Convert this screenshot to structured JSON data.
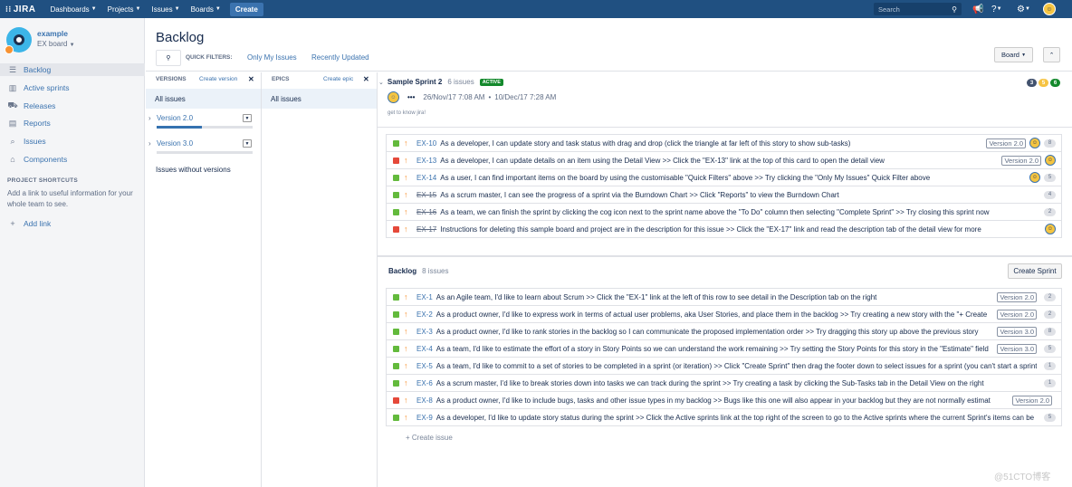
{
  "topnav": {
    "logo": "JIRA",
    "menus": [
      {
        "label": "Dashboards",
        "has_caret": true
      },
      {
        "label": "Projects",
        "has_caret": true
      },
      {
        "label": "Issues",
        "has_caret": true
      },
      {
        "label": "Boards",
        "has_caret": true
      }
    ],
    "create_label": "Create",
    "search_placeholder": "Search",
    "icons": [
      "megaphone-icon",
      "help-icon",
      "gear-icon",
      "user-avatar-icon"
    ]
  },
  "sidebar": {
    "project_name": "example",
    "board_name": "EX board",
    "nav": [
      {
        "label": "Backlog",
        "icon": "backlog-icon",
        "active": true
      },
      {
        "label": "Active sprints",
        "icon": "sprint-board-icon",
        "active": false
      },
      {
        "label": "Releases",
        "icon": "releases-icon",
        "active": false
      },
      {
        "label": "Reports",
        "icon": "reports-icon",
        "active": false
      },
      {
        "label": "Issues",
        "icon": "issues-icon",
        "active": false
      },
      {
        "label": "Components",
        "icon": "components-icon",
        "active": false
      }
    ],
    "shortcuts_heading": "PROJECT SHORTCUTS",
    "shortcuts_text": "Add a link to useful information for your whole team to see.",
    "add_link": "Add link"
  },
  "main": {
    "title": "Backlog",
    "quick_filters_label": "QUICK FILTERS:",
    "quick_filters": [
      "Only My Issues",
      "Recently Updated"
    ],
    "board_button": "Board",
    "versions": {
      "heading": "VERSIONS",
      "create_link": "Create version",
      "all": "All issues",
      "items": [
        {
          "name": "Version 2.0",
          "progress": 0.47
        },
        {
          "name": "Version 3.0",
          "progress": 0
        }
      ],
      "without": "Issues without versions"
    },
    "epics": {
      "heading": "EPICS",
      "create_link": "Create epic",
      "all": "All issues"
    },
    "sprint": {
      "name": "Sample Sprint 2",
      "count": "6 issues",
      "badge": "ACTIVE",
      "start": "26/Nov/17 7:08 AM",
      "end": "10/Dec/17 7:28 AM",
      "goal": "get to know jira!",
      "status_counts": [
        {
          "value": "3",
          "color": "#42526e"
        },
        {
          "value": "5",
          "color": "#f6c342"
        },
        {
          "value": "6",
          "color": "#14892c"
        }
      ],
      "issues": [
        {
          "type": "story",
          "key": "EX-10",
          "done": false,
          "summary": "As a developer, I can update story and task status with drag and drop (click the triangle at far left of this story to show sub-tasks)",
          "version": "Version 2.0",
          "avatar": true,
          "estimate": "8"
        },
        {
          "type": "bug",
          "key": "EX-13",
          "done": false,
          "summary": "As a developer, I can update details on an item using the Detail View >> Click the \"EX-13\" link at the top of this card to open the detail view",
          "version": "Version 2.0",
          "avatar": true,
          "estimate": ""
        },
        {
          "type": "story",
          "key": "EX-14",
          "done": false,
          "summary": "As a user, I can find important items on the board by using the customisable \"Quick Filters\" above >> Try clicking the \"Only My Issues\" Quick Filter above",
          "version": "",
          "avatar": true,
          "estimate": "5"
        },
        {
          "type": "story",
          "key": "EX-15",
          "done": true,
          "summary": "As a scrum master, I can see the progress of a sprint via the Burndown Chart >> Click \"Reports\" to view the Burndown Chart",
          "version": "",
          "avatar": false,
          "estimate": "4"
        },
        {
          "type": "story",
          "key": "EX-16",
          "done": true,
          "summary": "As a team, we can finish the sprint by clicking the cog icon next to the sprint name above the \"To Do\" column then selecting \"Complete Sprint\" >> Try closing this sprint now",
          "version": "",
          "avatar": false,
          "estimate": "2"
        },
        {
          "type": "bug",
          "key": "EX-17",
          "done": true,
          "summary": "Instructions for deleting this sample board and project are in the description for this issue >> Click the \"EX-17\" link and read the description tab of the detail view for more",
          "version": "",
          "avatar": true,
          "estimate": ""
        }
      ]
    },
    "backlog": {
      "name": "Backlog",
      "count": "8 issues",
      "create_sprint": "Create Sprint",
      "issues": [
        {
          "type": "story",
          "key": "EX-1",
          "summary": "As an Agile team, I'd like to learn about Scrum >> Click the \"EX-1\" link at the left of this row to see detail in the Description tab on the right",
          "version": "Version 2.0",
          "estimate": "2"
        },
        {
          "type": "story",
          "key": "EX-2",
          "summary": "As a product owner, I'd like to express work in terms of actual user problems, aka User Stories, and place them in the backlog >> Try creating a new story with the \"+ Create",
          "version": "Version 2.0",
          "estimate": "2"
        },
        {
          "type": "story",
          "key": "EX-3",
          "summary": "As a product owner, I'd like to rank stories in the backlog so I can communicate the proposed implementation order >> Try dragging this story up above the previous story",
          "version": "Version 3.0",
          "estimate": "8"
        },
        {
          "type": "story",
          "key": "EX-4",
          "summary": "As a team, I'd like to estimate the effort of a story in Story Points so we can understand the work remaining >> Try setting the Story Points for this story in the \"Estimate\" field",
          "version": "Version 3.0",
          "estimate": "5"
        },
        {
          "type": "story",
          "key": "EX-5",
          "summary": "As a team, I'd like to commit to a set of stories to be completed in a sprint (or iteration) >> Click \"Create Sprint\" then drag the footer down to select issues for a sprint (you can't start a sprint",
          "version": "",
          "estimate": "1"
        },
        {
          "type": "story",
          "key": "EX-6",
          "summary": "As a scrum master, I'd like to break stories down into tasks we can track during the sprint >> Try creating a task by clicking the Sub-Tasks tab in the Detail View on the right",
          "version": "",
          "estimate": "1"
        },
        {
          "type": "bug",
          "key": "EX-8",
          "summary": "As a product owner, I'd like to include bugs, tasks and other issue types in my backlog >> Bugs like this one will also appear in your backlog but they are not normally estimat",
          "version": "Version 2.0",
          "estimate": ""
        },
        {
          "type": "story",
          "key": "EX-9",
          "summary": "As a developer, I'd like to update story status during the sprint >> Click the Active sprints link at the top right of the screen to go to the Active sprints where the current Sprint's items can be",
          "version": "",
          "estimate": "5"
        }
      ],
      "create_issue": "+ Create issue"
    }
  },
  "watermark": "@51CTO博客"
}
